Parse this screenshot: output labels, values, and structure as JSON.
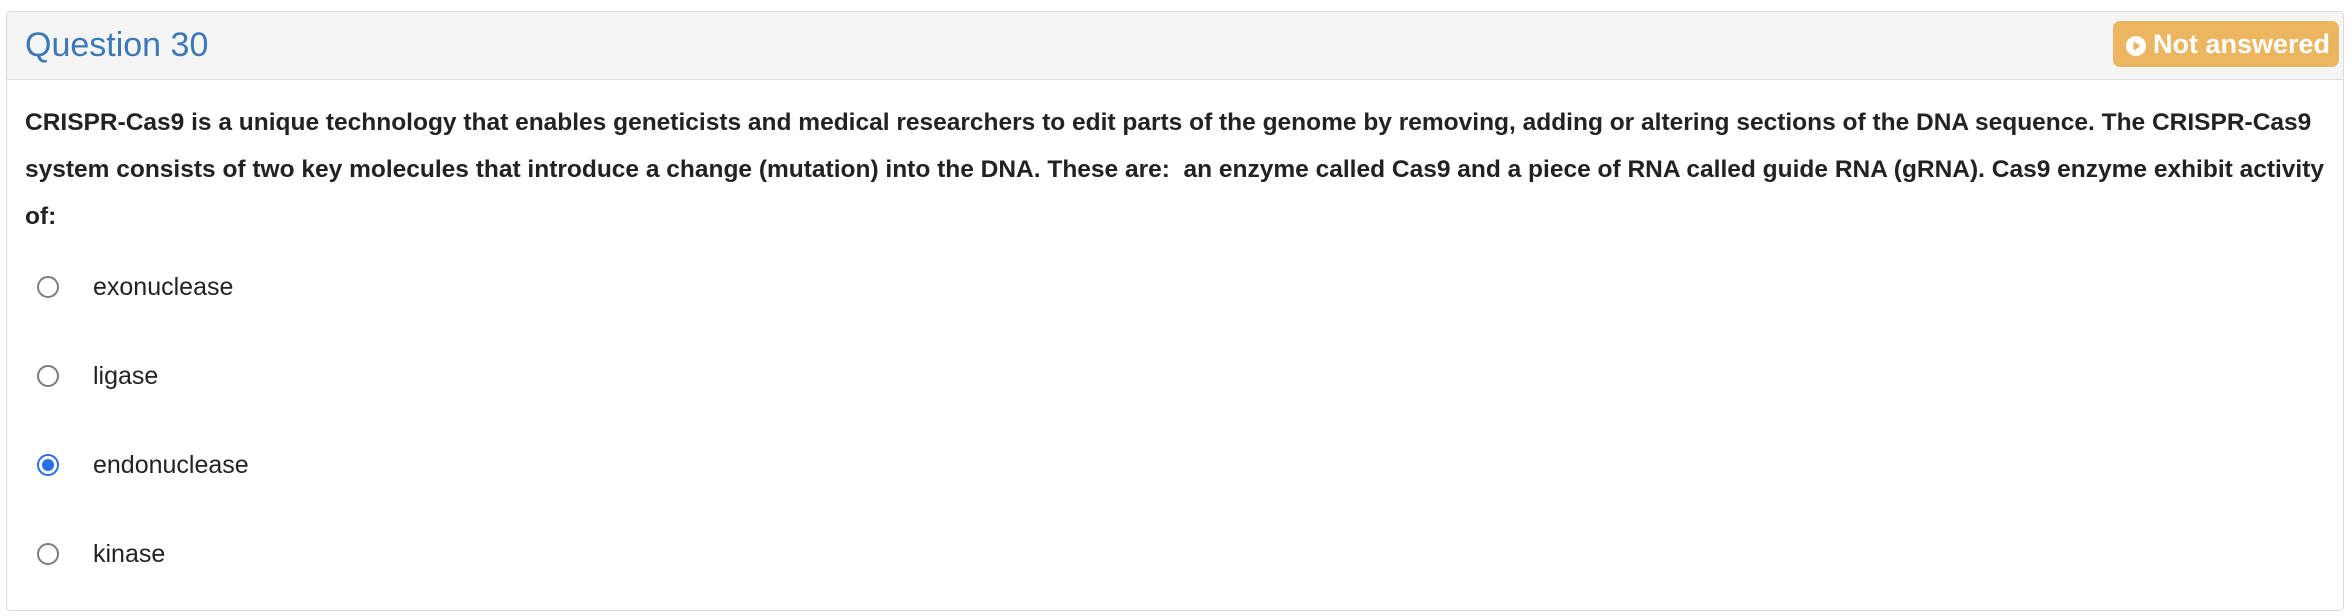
{
  "question": {
    "title": "Question 30",
    "status": "Not answered",
    "status_icon": "play-circle-icon",
    "status_color": "#ecb560",
    "title_color": "#3a78b7",
    "text": "CRISPR-Cas9 is a unique technology that enables geneticists and medical researchers to edit parts of the genome by removing, adding or altering sections of the DNA sequence. The CRISPR-Cas9 system consists of two key molecules that introduce a change (mutation) into the DNA. These are:  an enzyme called Cas9 and a piece of RNA called guide RNA (gRNA). Cas9 enzyme exhibit activity of:",
    "options": [
      {
        "label": "exonuclease",
        "selected": false
      },
      {
        "label": "ligase",
        "selected": false
      },
      {
        "label": "endonuclease",
        "selected": true
      },
      {
        "label": "kinase",
        "selected": false
      }
    ]
  }
}
